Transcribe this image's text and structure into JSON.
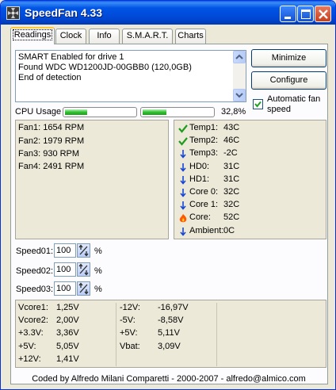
{
  "window": {
    "title": "SpeedFan 4.33"
  },
  "tabs": [
    {
      "label": "Readings"
    },
    {
      "label": "Clock"
    },
    {
      "label": "Info"
    },
    {
      "label": "S.M.A.R.T."
    },
    {
      "label": "Charts"
    }
  ],
  "log": {
    "lines": [
      "SMART Enabled for drive 1",
      "Found WDC WD1200JD-00GBB0 (120,0GB)",
      "End of detection"
    ]
  },
  "buttons": {
    "minimize": "Minimize",
    "configure": "Configure"
  },
  "auto_fan": {
    "label": "Automatic fan speed",
    "checked": true
  },
  "cpu": {
    "label": "CPU Usage",
    "percent_text": "32,8%",
    "core_usage": [
      0.32,
      0.34
    ]
  },
  "fans": [
    {
      "name": "Fan1:",
      "value": "1654 RPM"
    },
    {
      "name": "Fan2:",
      "value": "1979 RPM"
    },
    {
      "name": "Fan3:",
      "value": "930 RPM"
    },
    {
      "name": "Fan4:",
      "value": "2491 RPM"
    }
  ],
  "temps": [
    {
      "name": "Temp1:",
      "value": "43C",
      "icon": "check-icon"
    },
    {
      "name": "Temp2:",
      "value": "46C",
      "icon": "check-icon"
    },
    {
      "name": "Temp3:",
      "value": "-2C",
      "icon": "arrow-down-icon"
    },
    {
      "name": "HD0:",
      "value": "31C",
      "icon": "arrow-down-icon"
    },
    {
      "name": "HD1:",
      "value": "31C",
      "icon": "arrow-down-icon"
    },
    {
      "name": "Core 0:",
      "value": "32C",
      "icon": "arrow-down-icon"
    },
    {
      "name": "Core 1:",
      "value": "32C",
      "icon": "arrow-down-icon"
    },
    {
      "name": "Core:",
      "value": "52C",
      "icon": "flame-icon"
    },
    {
      "name": "Ambient:",
      "value": "0C",
      "icon": "arrow-down-icon"
    }
  ],
  "speeds": [
    {
      "label": "Speed01:",
      "value": "100",
      "unit": "%"
    },
    {
      "label": "Speed02:",
      "value": "100",
      "unit": "%"
    },
    {
      "label": "Speed03:",
      "value": "100",
      "unit": "%"
    }
  ],
  "voltages_left": [
    {
      "name": "Vcore1:",
      "value": "1,25V"
    },
    {
      "name": "Vcore2:",
      "value": "2,00V"
    },
    {
      "name": "+3.3V:",
      "value": "3,36V"
    },
    {
      "name": "+5V:",
      "value": "5,05V"
    },
    {
      "name": "+12V:",
      "value": "1,41V"
    }
  ],
  "voltages_right": [
    {
      "name": "-12V:",
      "value": "-16,97V"
    },
    {
      "name": "-5V:",
      "value": "-8,58V"
    },
    {
      "name": "+5V:",
      "value": "5,11V"
    },
    {
      "name": "Vbat:",
      "value": "3,09V"
    }
  ],
  "footer": "Coded by Alfredo Milani Comparetti - 2000-2007 - alfredo@almico.com",
  "colors": {
    "titlebar": "#0055e5",
    "check": "#1f9c1f",
    "arrow": "#1846d0",
    "flame": "#ff5a00",
    "cpu_bar": "#2ec02e"
  }
}
